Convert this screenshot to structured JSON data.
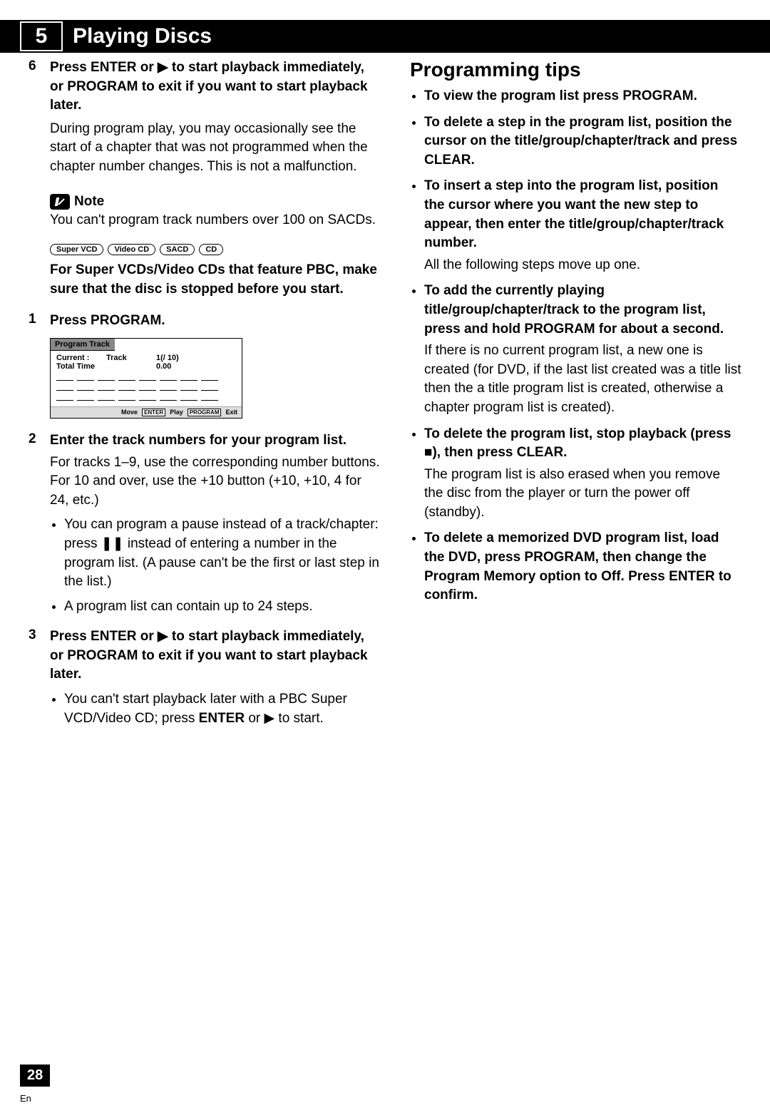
{
  "header": {
    "number": "5",
    "title": "Playing Discs"
  },
  "left": {
    "step6": {
      "num": "6",
      "bold": "Press ENTER or ▶ to start playback immediately, or PROGRAM to exit if you want to start playback later.",
      "para": "During program play, you may occasionally see the start of a chapter that was not programmed when the chapter number changes. This is not a malfunction."
    },
    "note": {
      "label": "Note",
      "text": "You can't program track numbers over 100 on SACDs."
    },
    "badges": [
      "Super VCD",
      "Video CD",
      "SACD",
      "CD"
    ],
    "pbc": "For Super VCDs/Video CDs that feature PBC, make sure that the disc is stopped before you start.",
    "step1": {
      "num": "1",
      "bold": "Press PROGRAM."
    },
    "osd": {
      "title": "Program Track",
      "r1a": "Current :",
      "r1b": "Track",
      "r1c": "1(/ 10)",
      "r2a": "Total Time",
      "r2c": "0.00",
      "foot_move": "Move",
      "foot_enter": "ENTER",
      "foot_play": "Play",
      "foot_program": "PROGRAM",
      "foot_exit": "Exit"
    },
    "step2": {
      "num": "2",
      "bold": "Enter the track numbers for your program list.",
      "para": "For tracks 1–9, use the corresponding number buttons. For 10 and over, use the +10 button (+10, +10, 4 for 24, etc.)",
      "b1": "You can program a pause instead of a track/chapter: press ❚❚ instead of entering a number in the program list. (A pause can't be the first or last step in the list.)",
      "b2": "A program list can contain up to 24 steps."
    },
    "step3": {
      "num": "3",
      "bold": "Press ENTER or ▶ to start playback immediately, or PROGRAM to exit if you want to start playback later.",
      "b1a": "You can't start playback later with a PBC Super VCD/Video CD; press ",
      "b1b": "ENTER",
      "b1c": " or ▶ to start."
    }
  },
  "right": {
    "title": "Programming tips",
    "t1": "To view the program list press PROGRAM.",
    "t2": "To delete a step in the program list, position the cursor on the title/group/chapter/track and press CLEAR.",
    "t3": "To insert a step into the program list, position the cursor where you want the new step to appear, then enter the title/group/chapter/track number.",
    "t3sub": "All the following steps move up one.",
    "t4": "To add the currently playing title/group/chapter/track to the program list, press and hold PROGRAM for about a second.",
    "t4sub": "If there is no current program list, a new one is created (for DVD, if the last list created was a title list then the a title program list is created, otherwise a chapter program list is created).",
    "t5": "To delete the program list, stop playback (press ■), then press CLEAR.",
    "t5sub": "The program list is also erased when you remove the disc from the player or turn the power off (standby).",
    "t6a": "To delete a memorized DVD program list, load the DVD, press PROGRAM, then change the ",
    "t6b": "Program Memory",
    "t6c": " option to ",
    "t6d": "Off",
    "t6e": ". Press ",
    "t6f": "ENTER",
    "t6g": " to confirm."
  },
  "footer": {
    "page": "28",
    "lang": "En"
  }
}
